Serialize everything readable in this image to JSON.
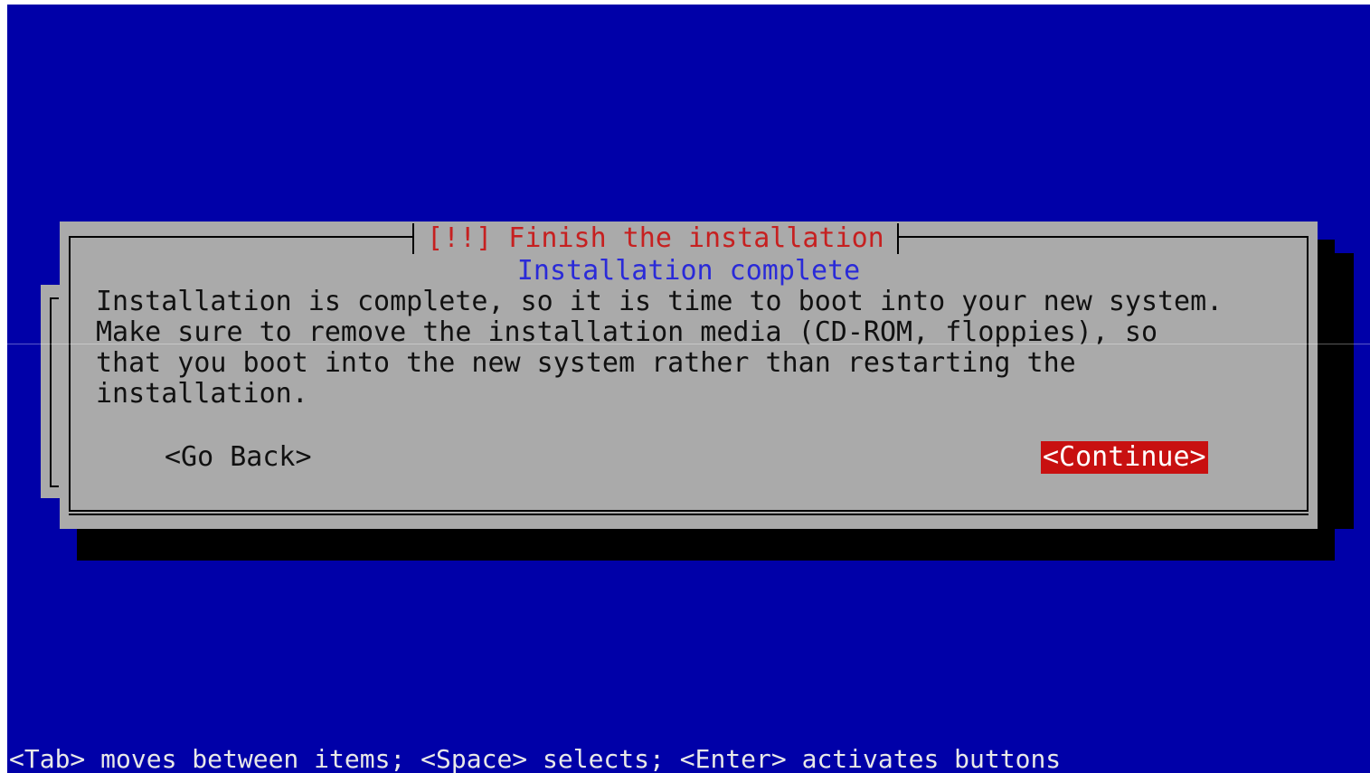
{
  "dialog": {
    "title": "[!!] Finish the installation",
    "subtitle": "Installation complete",
    "body_lines": [
      "Installation is complete, so it is time to boot into your new system.",
      "Make sure to remove the installation media (CD-ROM, floppies), so",
      "that you boot into the new system rather than restarting the",
      "installation."
    ],
    "buttons": {
      "go_back": "<Go Back>",
      "continue": "<Continue>"
    }
  },
  "help_line": "<Tab> moves between items; <Space> selects; <Enter> activates buttons",
  "colors": {
    "background": "#0000a8",
    "dialog": "#aaaaaa",
    "title": "#c62020",
    "subtitle": "#2a2ad8",
    "selected_button_bg": "#c81010",
    "selected_button_text": "#ffffff"
  }
}
